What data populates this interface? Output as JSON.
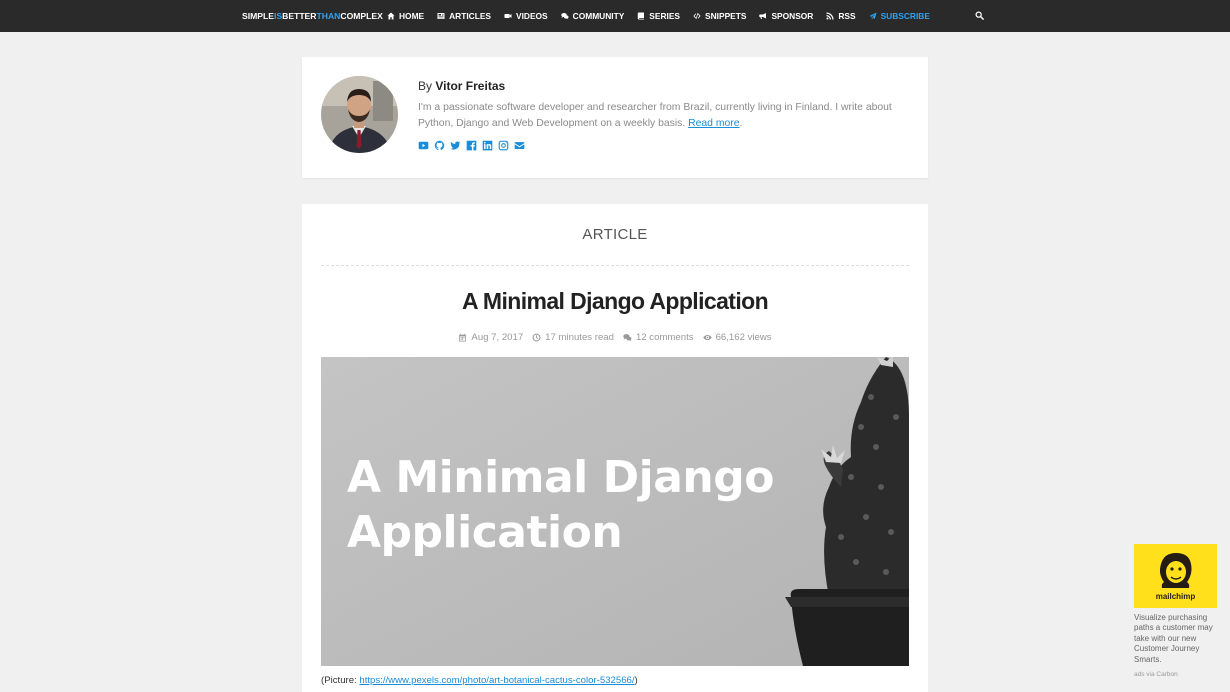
{
  "brand": {
    "part1": "SIMPLE",
    "part2": "IS",
    "part3": "BETTER",
    "part4": "THAN",
    "part5": "COMPLEX"
  },
  "nav": [
    {
      "label": "HOME",
      "icon": "home-icon"
    },
    {
      "label": "ARTICLES",
      "icon": "newspaper-icon"
    },
    {
      "label": "VIDEOS",
      "icon": "video-camera-icon"
    },
    {
      "label": "COMMUNITY",
      "icon": "comments-icon"
    },
    {
      "label": "SERIES",
      "icon": "book-icon"
    },
    {
      "label": "SNIPPETS",
      "icon": "code-icon"
    },
    {
      "label": "SPONSOR",
      "icon": "bullhorn-icon"
    },
    {
      "label": "RSS",
      "icon": "rss-icon"
    },
    {
      "label": "SUBSCRIBE",
      "icon": "paper-plane-icon"
    }
  ],
  "author": {
    "by": "By",
    "name": "Vitor Freitas",
    "bio": "I'm a passionate software developer and researcher from Brazil, currently living in Finland. I write about Python, Django and Web Development on a weekly basis.",
    "read_more": "Read more",
    "bio_end": ".",
    "socials": [
      "youtube-icon",
      "github-icon",
      "twitter-icon",
      "facebook-icon",
      "linkedin-icon",
      "instagram-icon",
      "envelope-icon"
    ]
  },
  "article": {
    "section": "ARTICLE",
    "title": "A Minimal Django Application",
    "date": "Aug 7, 2017",
    "read_time": "17 minutes read",
    "comments": "12 comments",
    "views": "66,162 views",
    "hero_text": "A Minimal Django Application",
    "caption_prefix": "(Picture: ",
    "caption_link": "https://www.pexels.com/photo/art-botanical-cactus-color-532566/",
    "caption_suffix": ")"
  },
  "ad": {
    "brand": "mailchimp",
    "text": "Visualize purchasing paths a customer may take with our new Customer Journey Smarts.",
    "via": "ads via Carbon"
  },
  "colors": {
    "navbar": "#2a2a2a",
    "accent": "#2ea3f2",
    "link": "#1a8cd8",
    "ad_bg": "#ffe01b"
  }
}
